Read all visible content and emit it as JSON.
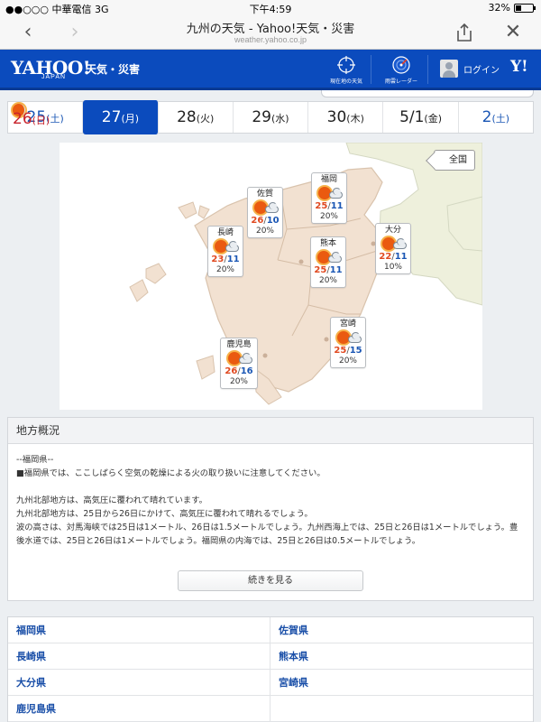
{
  "status_bar": {
    "carrier": "●●○○○ 中華電信  3G",
    "time": "下午4:59",
    "battery_text": "32%",
    "battery_level": 0.32
  },
  "browser": {
    "title": "九州の天気 - Yahoo!天気・災害",
    "url": "weather.yahoo.co.jp",
    "back_icon": "chevron-left-icon",
    "forward_icon": "chevron-right-icon",
    "share_icon": "share-icon",
    "close_icon": "close-icon"
  },
  "header": {
    "logo": "YAHOO!",
    "logo_sub": "JAPAN",
    "service": "天気・災害",
    "tools": [
      {
        "label": "現在地の天気",
        "icon": "crosshair-icon"
      },
      {
        "label": "雨雲レーダー",
        "icon": "radar-icon"
      }
    ],
    "login_label": "ログイン",
    "y_badge": "Y!",
    "brand_color": "#0b4bbd"
  },
  "dates": [
    {
      "day": "25",
      "dow": "(土)",
      "type": "sat"
    },
    {
      "day": "26",
      "dow": "(日)",
      "type": "sun"
    },
    {
      "day": "27",
      "dow": "(月)",
      "type": "active"
    },
    {
      "day": "28",
      "dow": "(火)",
      "type": "weekday"
    },
    {
      "day": "29",
      "dow": "(水)",
      "type": "weekday"
    },
    {
      "day": "30",
      "dow": "(木)",
      "type": "weekday"
    },
    {
      "day": "5/1",
      "dow": "(金)",
      "type": "weekday"
    },
    {
      "day": "2",
      "dow": "(土)",
      "type": "sat"
    }
  ],
  "map": {
    "all_country_label": "全国",
    "land_color": "#f2e1d1",
    "sea_color": "#ffffff",
    "forecasts": [
      {
        "city": "福岡",
        "hi": "25",
        "lo": "11",
        "pop": "20%",
        "icon": "sunny-cloudy-icon"
      },
      {
        "city": "佐賀",
        "hi": "26",
        "lo": "10",
        "pop": "20%",
        "icon": "sunny-cloudy-icon"
      },
      {
        "city": "長崎",
        "hi": "23",
        "lo": "11",
        "pop": "20%",
        "icon": "sunny-cloudy-icon"
      },
      {
        "city": "熊本",
        "hi": "25",
        "lo": "11",
        "pop": "20%",
        "icon": "sunny-cloudy-icon"
      },
      {
        "city": "大分",
        "hi": "22",
        "lo": "11",
        "pop": "10%",
        "icon": "sunny-cloudy-icon"
      },
      {
        "city": "宮崎",
        "hi": "25",
        "lo": "15",
        "pop": "20%",
        "icon": "sunny-cloudy-icon"
      },
      {
        "city": "鹿児島",
        "hi": "26",
        "lo": "16",
        "pop": "20%",
        "icon": "sunny-cloudy-icon"
      }
    ]
  },
  "overview": {
    "heading": "地方概況",
    "line1": "--福岡県--",
    "line2": "■福岡県では、ここしばらく空気の乾燥による火の取り扱いに注意してください。",
    "para1": "九州北部地方は、高気圧に覆われて晴れています。",
    "para2": "九州北部地方は、25日から26日にかけて、高気圧に覆われて晴れるでしょう。",
    "para3": "波の高さは、対馬海峡では25日は1メートル、26日は1.5メートルでしょう。九州西海上では、25日と26日は1メートルでしょう。豊後水道では、25日と26日は1メートルでしょう。福岡県の内海では、25日と26日は0.5メートルでしょう。",
    "more_label": "続きを見る"
  },
  "prefectures": [
    "福岡県",
    "佐賀県",
    "長崎県",
    "熊本県",
    "大分県",
    "宮崎県",
    "鹿児島県"
  ]
}
